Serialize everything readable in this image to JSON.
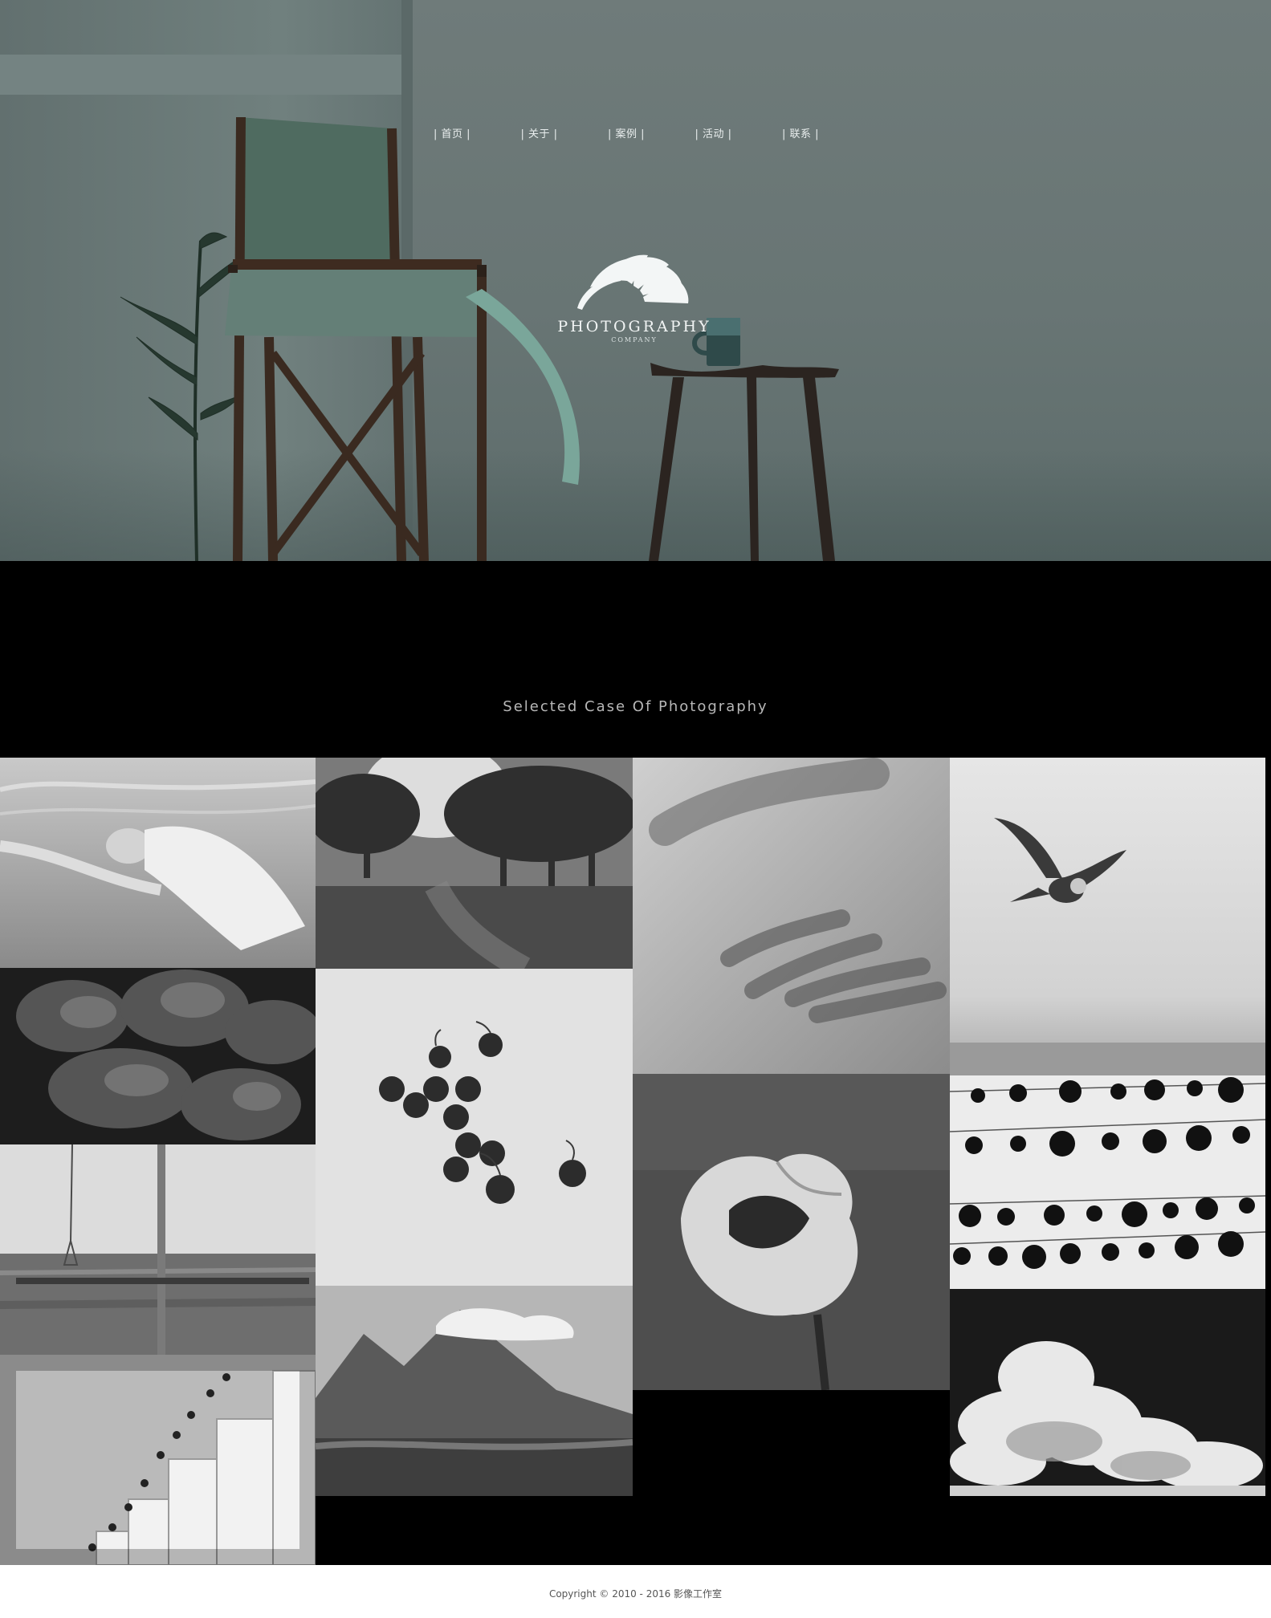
{
  "nav": {
    "items": [
      {
        "label": "| 首页 |"
      },
      {
        "label": "| 关于 |"
      },
      {
        "label": "| 案例 |"
      },
      {
        "label": "| 活动 |"
      },
      {
        "label": "| 联系 |"
      }
    ]
  },
  "logo": {
    "icon": "shell-fan-icon",
    "wordmark": "PHOTOGRAPHY",
    "subtitle": "COMPANY"
  },
  "cases": {
    "title": "Selected Case Of Photography",
    "items": [
      {
        "icon": "underwater-woman-photo"
      },
      {
        "icon": "dried-roses-photo"
      },
      {
        "icon": "seaside-pole-photo"
      },
      {
        "icon": "silos-photo"
      },
      {
        "icon": "tree-park-photo"
      },
      {
        "icon": "cherries-photo"
      },
      {
        "icon": "volcano-photo"
      },
      {
        "icon": "hand-shadow-photo"
      },
      {
        "icon": "poppy-flower-photo"
      },
      {
        "icon": "flying-owl-photo"
      },
      {
        "icon": "hanging-beads-photo"
      },
      {
        "icon": "clouds-photo"
      }
    ]
  },
  "footer": {
    "copyright": "Copyright © 2010 - 2016 影像工作室"
  },
  "colors": {
    "hero_tint": "#687574",
    "page_background": "#000000",
    "footer_background": "#ffffff"
  }
}
